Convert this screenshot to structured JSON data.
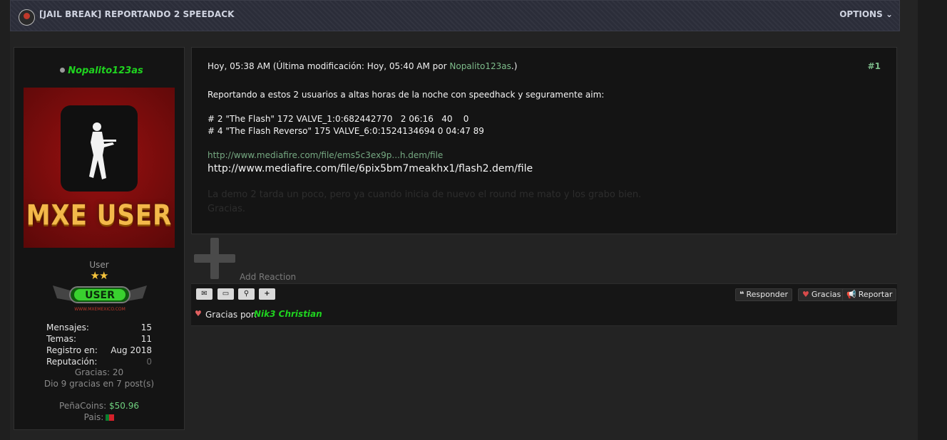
{
  "header": {
    "title": "[JAIL BREAK] REPORTANDO 2 SPEEDACK",
    "options_label": "OPTIONS",
    "options_arrow": "⌄"
  },
  "user": {
    "name": "Nopalito123as",
    "avatar_text": "MXE USER",
    "title": "User",
    "stars": "★★",
    "badge_text": "USER",
    "badge_caption": "WWW.MXEMEXICO.COM",
    "stats": [
      {
        "label": "Mensajes:",
        "value": "15"
      },
      {
        "label": "Temas:",
        "value": "11"
      },
      {
        "label": "Registro en:",
        "value": "Aug 2018"
      },
      {
        "label": "Reputación:",
        "value": "0"
      }
    ],
    "gracias": "Gracias: 20",
    "dio_gracias": "Dio 9 gracias en 7 post(s)",
    "coins_label": "PeñaCoins:",
    "coins_value": "$50.96",
    "pais_label": "Pais:"
  },
  "post": {
    "meta_prefix": "Hoy, 05:38 AM (Última modificación: Hoy, 05:40 AM por ",
    "meta_author": "Nopalito123as",
    "meta_suffix": ".)",
    "number": "#1",
    "intro": "Reportando a estos 2 usuarios a altas horas de la noche con speedhack y seguramente aim:",
    "line1": "# 2 \"The Flash\" 172 VALVE_1:0:682442770   2 06:16   40    0",
    "line2": "# 4 \"The Flash Reverso\" 175 VALVE_6:0:1524134694 0 04:47 89",
    "link_short": "http://www.mediafire.com/file/ems5c3ex9p...h.dem/file",
    "link_full": "http://www.mediafire.com/file/6pix5bm7meakhx1/flash2.dem/file",
    "faint1": "La demo 2 tarda un poco, pero ya cuando inicia de nuevo el round me mato y los grabo bien.",
    "faint2": "Gracias."
  },
  "reaction": {
    "label": "Add Reaction"
  },
  "actions": {
    "email_icon": "✉",
    "pm_icon": "▭",
    "search_icon": "⚲",
    "add_icon": "+",
    "reply": {
      "icon": "❝",
      "label": "Responder"
    },
    "thanks": {
      "icon": "♥",
      "label": "Gracias"
    },
    "report": {
      "icon": "📢",
      "label": "Reportar"
    }
  },
  "thanks_bar": {
    "icon": "♥",
    "label": "Gracias por:",
    "user": "Nik3 Christian"
  }
}
